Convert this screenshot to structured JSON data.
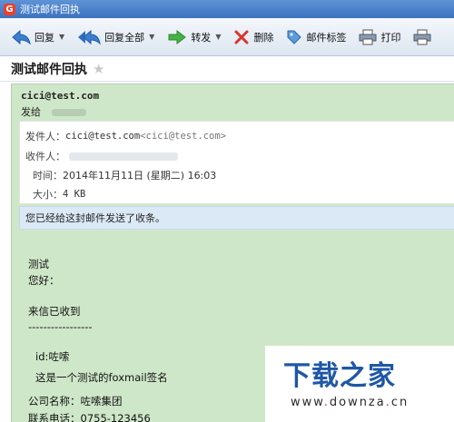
{
  "window": {
    "title": "测试邮件回执"
  },
  "toolbar": {
    "reply": "回复",
    "reply_all": "回复全部",
    "forward": "转发",
    "delete": "删除",
    "tag": "邮件标签",
    "print": "打印"
  },
  "subject": "测试邮件回执",
  "header": {
    "sender_email": "cici@test.com",
    "send_to_label": "发给"
  },
  "info": {
    "from_label": "发件人：",
    "from_value": "cici@test.com",
    "from_angle": "<cici@test.com>",
    "to_label": "收件人：",
    "time_label": "时间：",
    "time_value": "2014年11月11日 (星期二) 16:03",
    "size_label": "大小：",
    "size_value": "4 KB"
  },
  "receipt_notice": "您已经给这封邮件发送了收条。",
  "body": {
    "line1": "测试",
    "line2": "您好：",
    "line3": "来信已收到",
    "line4": "-----------------",
    "line5": "id:咗嗦",
    "line6": "这是一个测试的foxmail签名",
    "line7": "公司名称：咗嗦集团",
    "line8": "联系电话：0755-123456"
  },
  "watermark": {
    "logo": "下载之家",
    "url_prefix": "www",
    "url_dot1": ".",
    "url_mid": "downza",
    "url_dot2": ".",
    "url_suffix": "cn"
  },
  "colors": {
    "title_bar": "#4a80c8",
    "mail_bg": "#cfe7c9",
    "receipt_bg": "#dbe9f6",
    "watermark_blue": "#1f57a6"
  }
}
